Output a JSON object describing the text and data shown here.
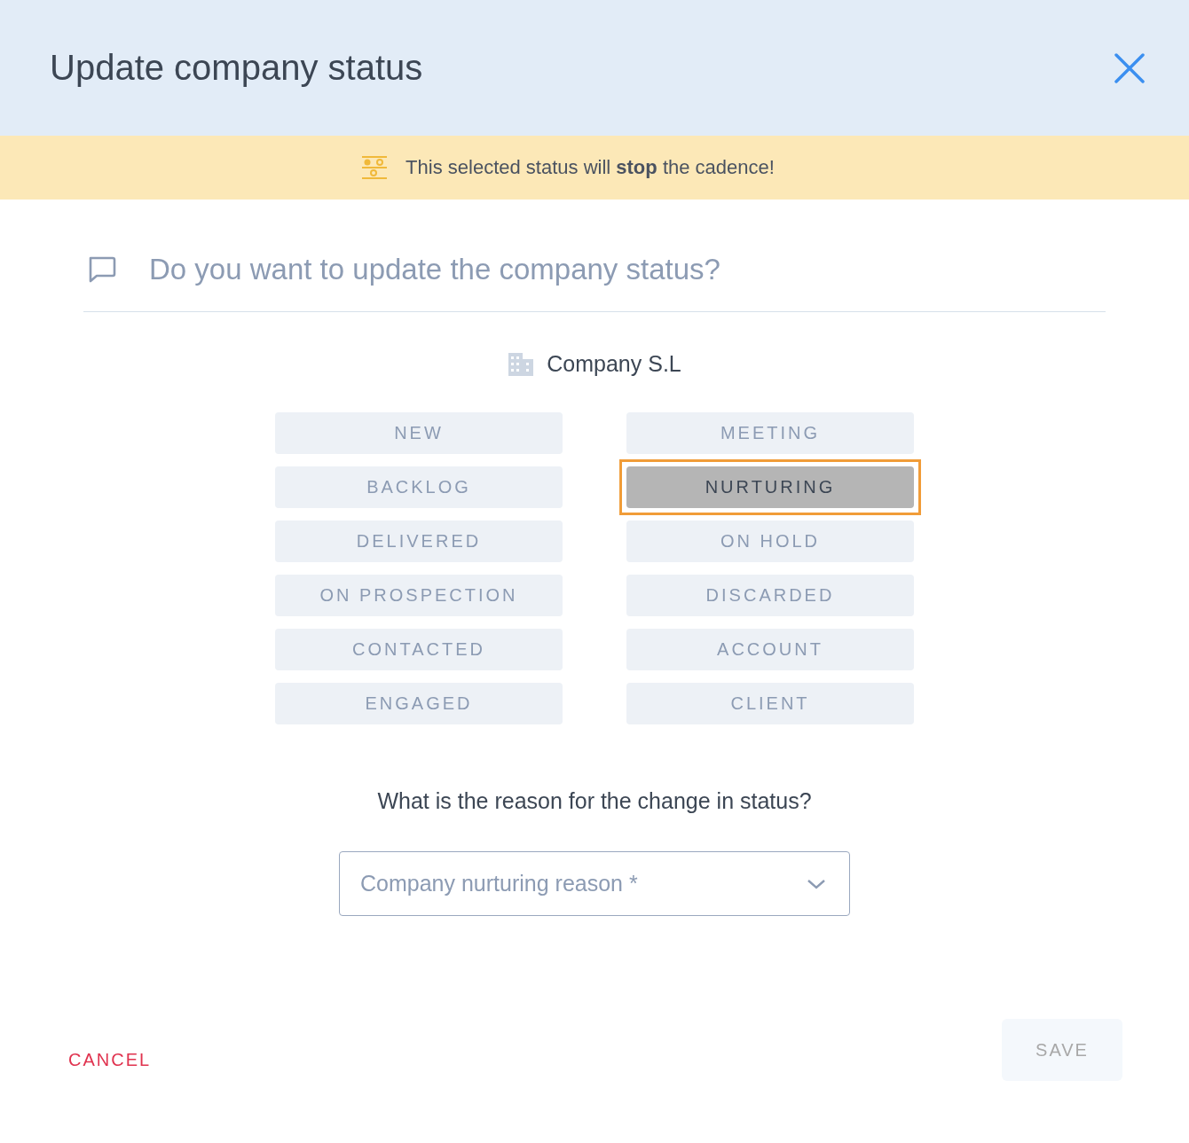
{
  "dialog": {
    "title": "Update company status"
  },
  "banner": {
    "text": "This selected status will **stop** the cadence!"
  },
  "question": "Do you want to update the company status?",
  "company": "Company S.L",
  "status_columns": [
    [
      {
        "label": "NEW",
        "selected": false
      },
      {
        "label": "BACKLOG",
        "selected": false
      },
      {
        "label": "DELIVERED",
        "selected": false
      },
      {
        "label": "ON PROSPECTION",
        "selected": false
      },
      {
        "label": "CONTACTED",
        "selected": false
      },
      {
        "label": "ENGAGED",
        "selected": false
      }
    ],
    [
      {
        "label": "MEETING",
        "selected": false
      },
      {
        "label": "NURTURING",
        "selected": true
      },
      {
        "label": "ON HOLD",
        "selected": false
      },
      {
        "label": "DISCARDED",
        "selected": false
      },
      {
        "label": "ACCOUNT",
        "selected": false
      },
      {
        "label": "CLIENT",
        "selected": false
      }
    ]
  ],
  "reason": {
    "label": "What is the reason for the change in status?",
    "placeholder": "Company nurturing reason *"
  },
  "buttons": {
    "cancel": "CANCEL",
    "save": {
      "label": "SAVE",
      "disabled": true
    }
  }
}
